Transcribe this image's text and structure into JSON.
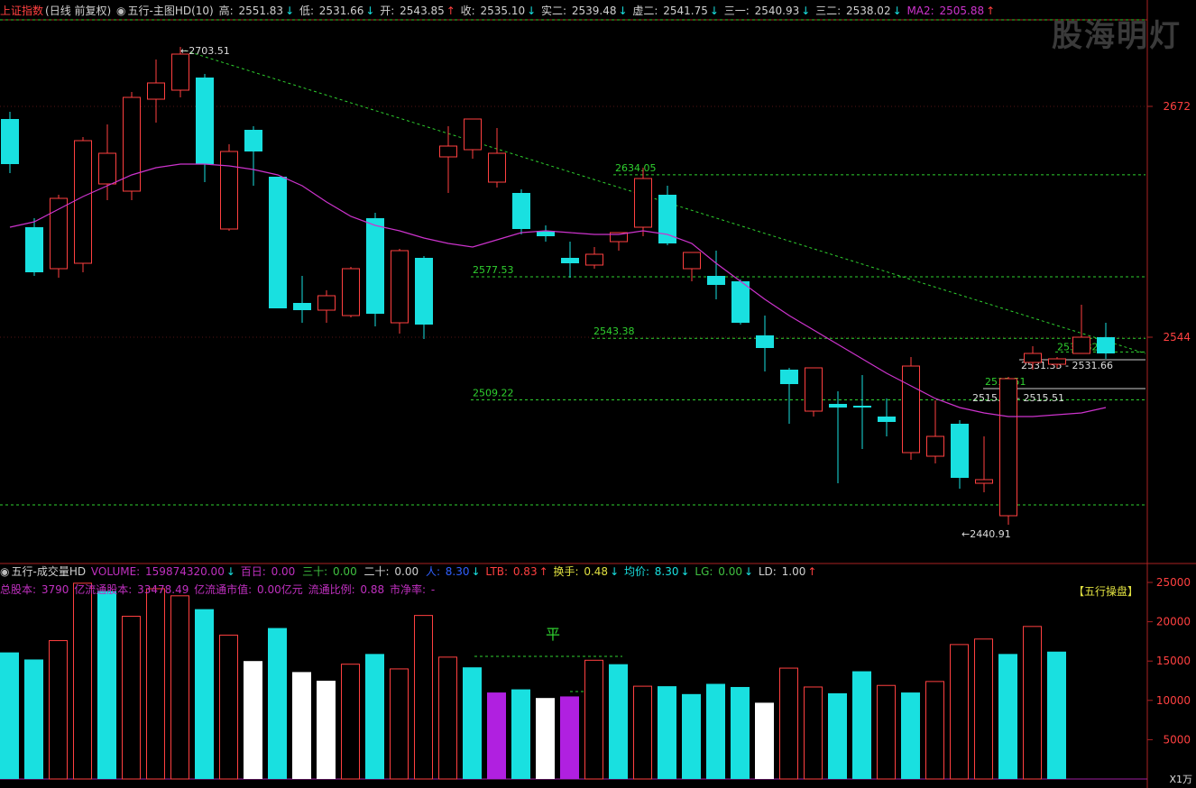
{
  "main_header": {
    "index_name": "上证指数",
    "period_mode": "(日线 前复权)",
    "indicator_name": "五行-主图HD(10)",
    "fields": [
      {
        "label": "高:",
        "value": "2551.83",
        "dir": "down"
      },
      {
        "label": "低:",
        "value": "2531.66",
        "dir": "down"
      },
      {
        "label": "开:",
        "value": "2543.85",
        "dir": "up"
      },
      {
        "label": "收:",
        "value": "2535.10",
        "dir": "down"
      },
      {
        "label": "实二:",
        "value": "2539.48",
        "dir": "down"
      },
      {
        "label": "虚二:",
        "value": "2541.75",
        "dir": "down"
      },
      {
        "label": "三一:",
        "value": "2540.93",
        "dir": "down"
      },
      {
        "label": "三二:",
        "value": "2538.02",
        "dir": "down"
      },
      {
        "label": "MA2:",
        "value": "2505.88",
        "dir": "up"
      }
    ]
  },
  "watermark": "股海明灯",
  "vol_header": {
    "indicator_name": "五行-成交量HD",
    "fields": [
      {
        "label": "VOLUME:",
        "value": "159874320.00",
        "dir": "down",
        "color": "#c030c0"
      },
      {
        "label": "百日:",
        "value": "0.00",
        "dir": "",
        "color": "#c030c0"
      },
      {
        "label": "三十:",
        "value": "0.00",
        "dir": "",
        "color": "#40c040"
      },
      {
        "label": "二十:",
        "value": "0.00",
        "dir": "",
        "color": "#d0d0d0"
      },
      {
        "label": "人:",
        "value": "8.30",
        "dir": "down",
        "color": "#3060ff"
      },
      {
        "label": "LTB:",
        "value": "0.83",
        "dir": "up",
        "color": "#ff4040"
      },
      {
        "label": "换手:",
        "value": "0.48",
        "dir": "down",
        "color": "#e0e040"
      },
      {
        "label": "均价:",
        "value": "8.30",
        "dir": "down",
        "color": "#19e0e0"
      },
      {
        "label": "LG:",
        "value": "0.00",
        "dir": "down",
        "color": "#40c040"
      },
      {
        "label": "LD:",
        "value": "1.00",
        "dir": "up",
        "color": "#d0d0d0"
      }
    ],
    "stats": [
      {
        "label": "总股本:",
        "value": "3790"
      },
      {
        "label": "亿流通股本:",
        "value": "33478.49"
      },
      {
        "label": "亿流通市值:",
        "value": "0.00亿元"
      },
      {
        "label": "流通比例:",
        "value": "0.88"
      },
      {
        "label": "市净率:",
        "value": "-"
      }
    ],
    "badge": "【五行操盘】",
    "ping_label": "平"
  },
  "colors": {
    "up": "#ff4040",
    "down": "#19e0e0",
    "ma": "#cc33cc",
    "guide": "#2fd02f",
    "axis": "#aa2222",
    "purple_bar": "#b020e0",
    "white_bar": "#ffffff"
  },
  "chart_data": [
    {
      "type": "candlestick",
      "title": "",
      "y_ticks": [
        2672,
        2544
      ],
      "annotations": {
        "high_label": "2703.51",
        "low_label": "2440.91",
        "level_2634": "2634.05",
        "level_2577": "2577.53",
        "level_2543": "2543.38",
        "level_2509": "2509.22",
        "level_2535": "2535.82",
        "level_2515": "2515.51",
        "range_1": "2531.35 - 2531.66",
        "range_2": "2515.32 - 2515.51"
      },
      "candles": [
        {
          "o": 2665,
          "h": 2669,
          "c": 2640,
          "l": 2635
        },
        {
          "o": 2605,
          "h": 2610,
          "c": 2580,
          "l": 2578
        },
        {
          "o": 2582,
          "h": 2623,
          "c": 2621,
          "l": 2577
        },
        {
          "o": 2585,
          "h": 2655,
          "c": 2653,
          "l": 2580
        },
        {
          "o": 2629,
          "h": 2662,
          "c": 2646,
          "l": 2620
        },
        {
          "o": 2625,
          "h": 2680,
          "c": 2677,
          "l": 2620
        },
        {
          "o": 2676,
          "h": 2698,
          "c": 2685,
          "l": 2663
        },
        {
          "o": 2681,
          "h": 2705,
          "c": 2701,
          "l": 2677
        },
        {
          "o": 2688,
          "h": 2690,
          "c": 2640,
          "l": 2630
        },
        {
          "o": 2604,
          "h": 2651,
          "c": 2647,
          "l": 2603
        },
        {
          "o": 2659,
          "h": 2661,
          "c": 2647,
          "l": 2628
        },
        {
          "o": 2633,
          "h": 2633,
          "c": 2560,
          "l": 2560
        },
        {
          "o": 2563,
          "h": 2578,
          "c": 2559,
          "l": 2552
        },
        {
          "o": 2559,
          "h": 2570,
          "c": 2567,
          "l": 2552
        },
        {
          "o": 2556,
          "h": 2583,
          "c": 2582,
          "l": 2555
        },
        {
          "o": 2610,
          "h": 2613,
          "c": 2557,
          "l": 2550
        },
        {
          "o": 2552,
          "h": 2593,
          "c": 2592,
          "l": 2546
        },
        {
          "o": 2588,
          "h": 2589,
          "c": 2551,
          "l": 2543
        },
        {
          "o": 2644,
          "h": 2661,
          "c": 2650,
          "l": 2624
        },
        {
          "o": 2648,
          "h": 2660,
          "c": 2665,
          "l": 2643
        },
        {
          "o": 2630,
          "h": 2660,
          "c": 2646,
          "l": 2627
        },
        {
          "o": 2624,
          "h": 2626,
          "c": 2604,
          "l": 2601
        },
        {
          "o": 2603,
          "h": 2606,
          "c": 2600,
          "l": 2597
        },
        {
          "o": 2588,
          "h": 2597,
          "c": 2585,
          "l": 2577
        },
        {
          "o": 2584,
          "h": 2594,
          "c": 2590,
          "l": 2582
        },
        {
          "o": 2597,
          "h": 2602,
          "c": 2602,
          "l": 2592
        },
        {
          "o": 2605,
          "h": 2638,
          "c": 2632,
          "l": 2600
        },
        {
          "o": 2623,
          "h": 2628,
          "c": 2596,
          "l": 2595
        },
        {
          "o": 2582,
          "h": 2589,
          "c": 2591,
          "l": 2575
        },
        {
          "o": 2578,
          "h": 2592,
          "c": 2573,
          "l": 2565
        },
        {
          "o": 2575,
          "h": 2576,
          "c": 2552,
          "l": 2551
        },
        {
          "o": 2545,
          "h": 2556,
          "c": 2538,
          "l": 2525
        },
        {
          "o": 2526,
          "h": 2527,
          "c": 2518,
          "l": 2496
        },
        {
          "o": 2503,
          "h": 2527,
          "c": 2527,
          "l": 2500
        },
        {
          "o": 2507,
          "h": 2514,
          "c": 2505,
          "l": 2463
        },
        {
          "o": 2506,
          "h": 2523,
          "c": 2505,
          "l": 2482
        },
        {
          "o": 2500,
          "h": 2510,
          "c": 2497,
          "l": 2489
        },
        {
          "o": 2480,
          "h": 2533,
          "c": 2528,
          "l": 2476
        },
        {
          "o": 2478,
          "h": 2509,
          "c": 2489,
          "l": 2474
        },
        {
          "o": 2496,
          "h": 2498,
          "c": 2466,
          "l": 2460
        },
        {
          "o": 2463,
          "h": 2489,
          "c": 2465,
          "l": 2458
        },
        {
          "o": 2445,
          "h": 2522,
          "c": 2521,
          "l": 2440
        },
        {
          "o": 2530,
          "h": 2539,
          "c": 2535,
          "l": 2526
        },
        {
          "o": 2529,
          "h": 2533,
          "c": 2532,
          "l": 2527
        },
        {
          "o": 2535,
          "h": 2562,
          "c": 2544,
          "l": 2535
        },
        {
          "o": 2544,
          "h": 2552,
          "c": 2535,
          "l": 2532
        }
      ],
      "ma2": [
        2605,
        2608,
        2615,
        2622,
        2628,
        2634,
        2638,
        2640,
        2640,
        2639,
        2637,
        2634,
        2628,
        2619,
        2611,
        2606,
        2603,
        2599,
        2596,
        2594,
        2598,
        2602,
        2603,
        2602,
        2601,
        2601,
        2603,
        2601,
        2596,
        2585,
        2575,
        2565,
        2556,
        2548,
        2540,
        2532,
        2524,
        2517,
        2510,
        2505,
        2502,
        2500,
        2500,
        2501,
        2502,
        2505
      ]
    },
    {
      "type": "bar",
      "title": "",
      "y_ticks": [
        25000,
        20000,
        15000,
        10000,
        5000
      ],
      "y_unit": "X1万",
      "volume_values": [
        16100,
        15200,
        17600,
        24900,
        23900,
        20700,
        24200,
        23300,
        21600,
        18300,
        15000,
        19200,
        13600,
        12500,
        14600,
        15900,
        14000,
        20800,
        15500,
        14200,
        11000,
        11400,
        10300,
        10500,
        15100,
        14600,
        11800,
        11800,
        10800,
        12100,
        11700,
        9700,
        14100,
        11700,
        10900,
        13700,
        11900,
        11000,
        12400,
        17100,
        17800,
        15900,
        19400,
        16200
      ],
      "volume_colors": [
        "down",
        "down",
        "up",
        "up",
        "down",
        "up",
        "up",
        "up",
        "down",
        "up",
        "white",
        "down",
        "white",
        "white",
        "up",
        "down",
        "up",
        "up",
        "up",
        "down",
        "purple",
        "down",
        "white",
        "purple",
        "up",
        "down",
        "up",
        "down",
        "down",
        "down",
        "down",
        "white",
        "up",
        "up",
        "down",
        "down",
        "up",
        "down",
        "up",
        "up",
        "up",
        "down",
        "up",
        "down"
      ]
    }
  ]
}
